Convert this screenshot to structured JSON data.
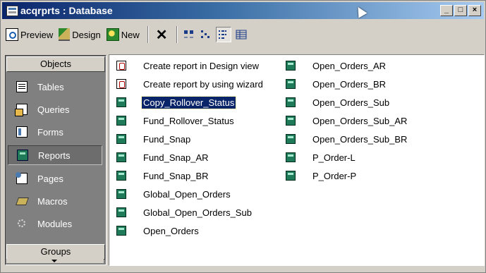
{
  "window": {
    "title": "acqrprts : Database",
    "buttons": {
      "minimize": "_",
      "maximize": "□",
      "close": "×"
    }
  },
  "toolbar": {
    "preview_label": "Preview",
    "design_label": "Design",
    "new_label": "New",
    "delete_label": "✕"
  },
  "objects_bar": {
    "header": "Objects",
    "items": [
      {
        "label": "Tables",
        "icon": "table-icon"
      },
      {
        "label": "Queries",
        "icon": "query-icon"
      },
      {
        "label": "Forms",
        "icon": "form-icon"
      },
      {
        "label": "Reports",
        "icon": "report-icon",
        "selected": true
      },
      {
        "label": "Pages",
        "icon": "page-icon"
      },
      {
        "label": "Macros",
        "icon": "macro-icon"
      },
      {
        "label": "Modules",
        "icon": "module-icon"
      }
    ],
    "groups_label": "Groups"
  },
  "list": {
    "column1": [
      {
        "label": "Create report in Design view",
        "icon": "create-icon"
      },
      {
        "label": "Create report by using wizard",
        "icon": "create-icon"
      },
      {
        "label": "Copy_Rollover_Status",
        "icon": "report-icon",
        "selected": true
      },
      {
        "label": "Fund_Rollover_Status",
        "icon": "report-icon"
      },
      {
        "label": "Fund_Snap",
        "icon": "report-icon"
      },
      {
        "label": "Fund_Snap_AR",
        "icon": "report-icon"
      },
      {
        "label": "Fund_Snap_BR",
        "icon": "report-icon"
      },
      {
        "label": "Global_Open_Orders",
        "icon": "report-icon"
      },
      {
        "label": "Global_Open_Orders_Sub",
        "icon": "report-icon"
      },
      {
        "label": "Open_Orders",
        "icon": "report-icon"
      }
    ],
    "column2": [
      {
        "label": "Open_Orders_AR",
        "icon": "report-icon"
      },
      {
        "label": "Open_Orders_BR",
        "icon": "report-icon"
      },
      {
        "label": "Open_Orders_Sub",
        "icon": "report-icon"
      },
      {
        "label": "Open_Orders_Sub_AR",
        "icon": "report-icon"
      },
      {
        "label": "Open_Orders_Sub_BR",
        "icon": "report-icon"
      },
      {
        "label": "P_Order-L",
        "icon": "report-icon"
      },
      {
        "label": "P_Order-P",
        "icon": "report-icon"
      }
    ]
  },
  "colors": {
    "title_gradient_start": "#0a246a",
    "selection": "#0a246a",
    "objects_bar_bg": "#808080"
  }
}
